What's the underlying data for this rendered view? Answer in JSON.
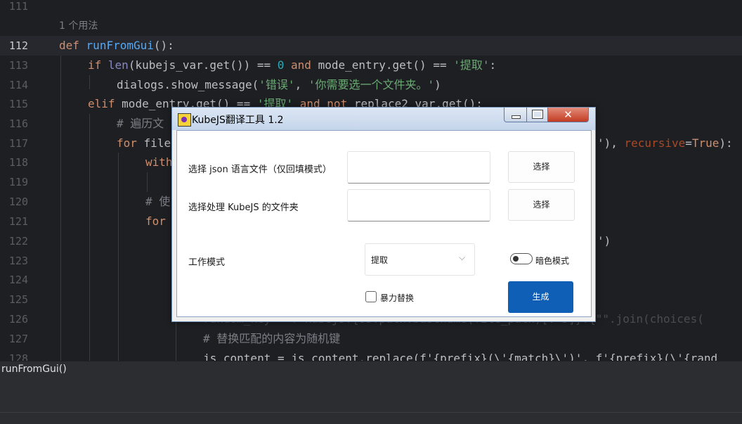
{
  "editor": {
    "line_numbers": [
      "111",
      "112",
      "113",
      "114",
      "115",
      "116",
      "117",
      "118",
      "119",
      "120",
      "121",
      "122",
      "123",
      "124",
      "125",
      "126",
      "127",
      "128"
    ],
    "usage_hint": "1 个用法",
    "code": {
      "l112_def": "def",
      "l112_fn": "runFromGui",
      "l112_rest": "():",
      "l113_if": "if",
      "l113_len": "len",
      "l113_a": "(kubejs_var.get()) == ",
      "l113_zero": "0",
      "l113_and": "and",
      "l113_b": "mode_entry.get() == ",
      "l113_str": "'提取'",
      "l113_c": ":",
      "l114_a": "dialogs.show_message(",
      "l114_s1": "'错误'",
      "l114_b": ", ",
      "l114_s2": "'你需要选一个文件夹。'",
      "l114_c": ")",
      "l115_elif": "elif",
      "l115_a": "mode_entry.get() == ",
      "l115_str": "'提取'",
      "l115_and": "and",
      "l115_not": "not",
      "l115_b": "replace2_var.get():",
      "l116_cm": "# 遍历文",
      "l117_for": "for",
      "l117_a": "file",
      "l117_b": "'), ",
      "l117_param": "recursive",
      "l117_c": "=",
      "l117_true": "True",
      "l117_d": "):",
      "l118_with": "with",
      "l120_cm": "# 使",
      "l121_for": "for",
      "l122_a": "')",
      "l126_a": "random_key = f'kubejs:{os.path.basename(file_path)[:-3]}.{\"\".join(choices(",
      "l127_cm": "# 替换匹配的内容为随机键",
      "l128_a": "js_content = js_content.replace(f'{prefix}(\\'{match}\\')', f'{prefix}(\\'{rand"
    }
  },
  "statusbar": {
    "breadcrumb": "runFromGui()"
  },
  "dialog": {
    "title": "KubeJS翻译工具 1.2",
    "close_glyph": "✕",
    "label_json": "选择 json 语言文件（仅回填模式）",
    "label_folder": "选择处理 KubeJS 的文件夹",
    "select_btn_1": "选择",
    "select_btn_2": "选择",
    "json_path_value": "",
    "folder_path_value": "",
    "label_mode": "工作模式",
    "mode_selected": "提取",
    "mode_chevron": "⌵",
    "dark_mode_label": "暗色模式",
    "dark_mode_on": false,
    "force_replace_label": "暴力替换",
    "force_replace_checked": false,
    "generate_label": "生成",
    "accent_color": "#0f5fb7"
  }
}
